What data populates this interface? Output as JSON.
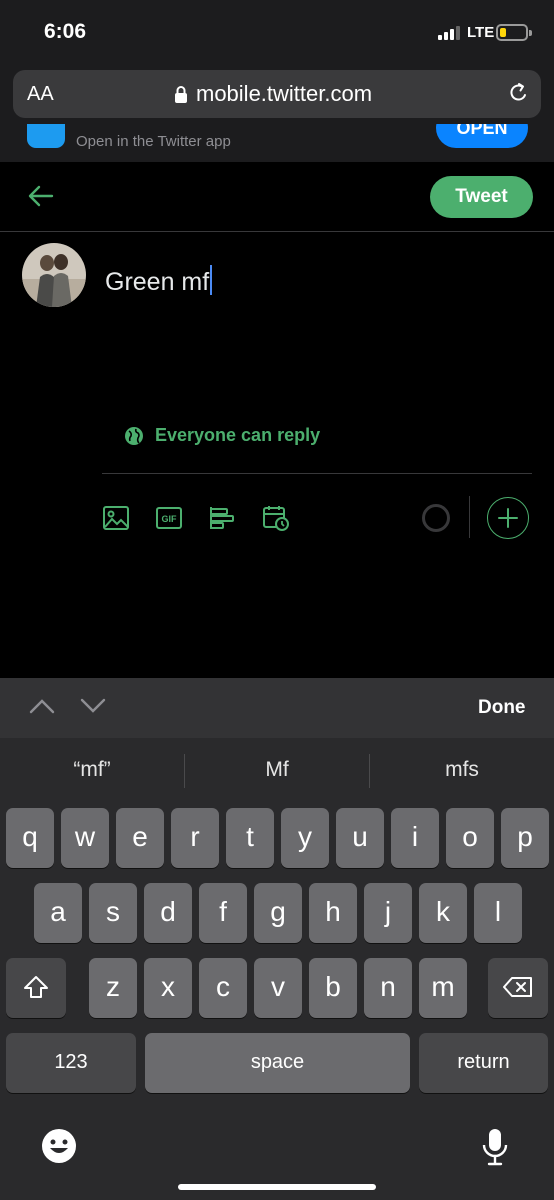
{
  "status_bar": {
    "time": "6:06",
    "network": "LTE"
  },
  "browser": {
    "text_size_label": "AA",
    "url": "mobile.twitter.com"
  },
  "app_banner": {
    "text": "Open in the Twitter app",
    "open_label": "OPEN"
  },
  "compose": {
    "tweet_label": "Tweet",
    "draft_text": "Green mf",
    "reply_setting": "Everyone can reply",
    "toolbar": [
      "image-icon",
      "gif-icon",
      "poll-icon",
      "schedule-icon"
    ],
    "gif_label": "GIF"
  },
  "keyboard": {
    "done_label": "Done",
    "suggestions": [
      "“mf”",
      "Mf",
      "mfs"
    ],
    "row1": [
      "q",
      "w",
      "e",
      "r",
      "t",
      "y",
      "u",
      "i",
      "o",
      "p"
    ],
    "row2": [
      "a",
      "s",
      "d",
      "f",
      "g",
      "h",
      "j",
      "k",
      "l"
    ],
    "row3": [
      "z",
      "x",
      "c",
      "v",
      "b",
      "n",
      "m"
    ],
    "numbers_label": "123",
    "space_label": "space",
    "return_label": "return"
  },
  "colors": {
    "accent": "#4caf6e",
    "link_blue": "#0a84ff",
    "background": "#000000"
  }
}
